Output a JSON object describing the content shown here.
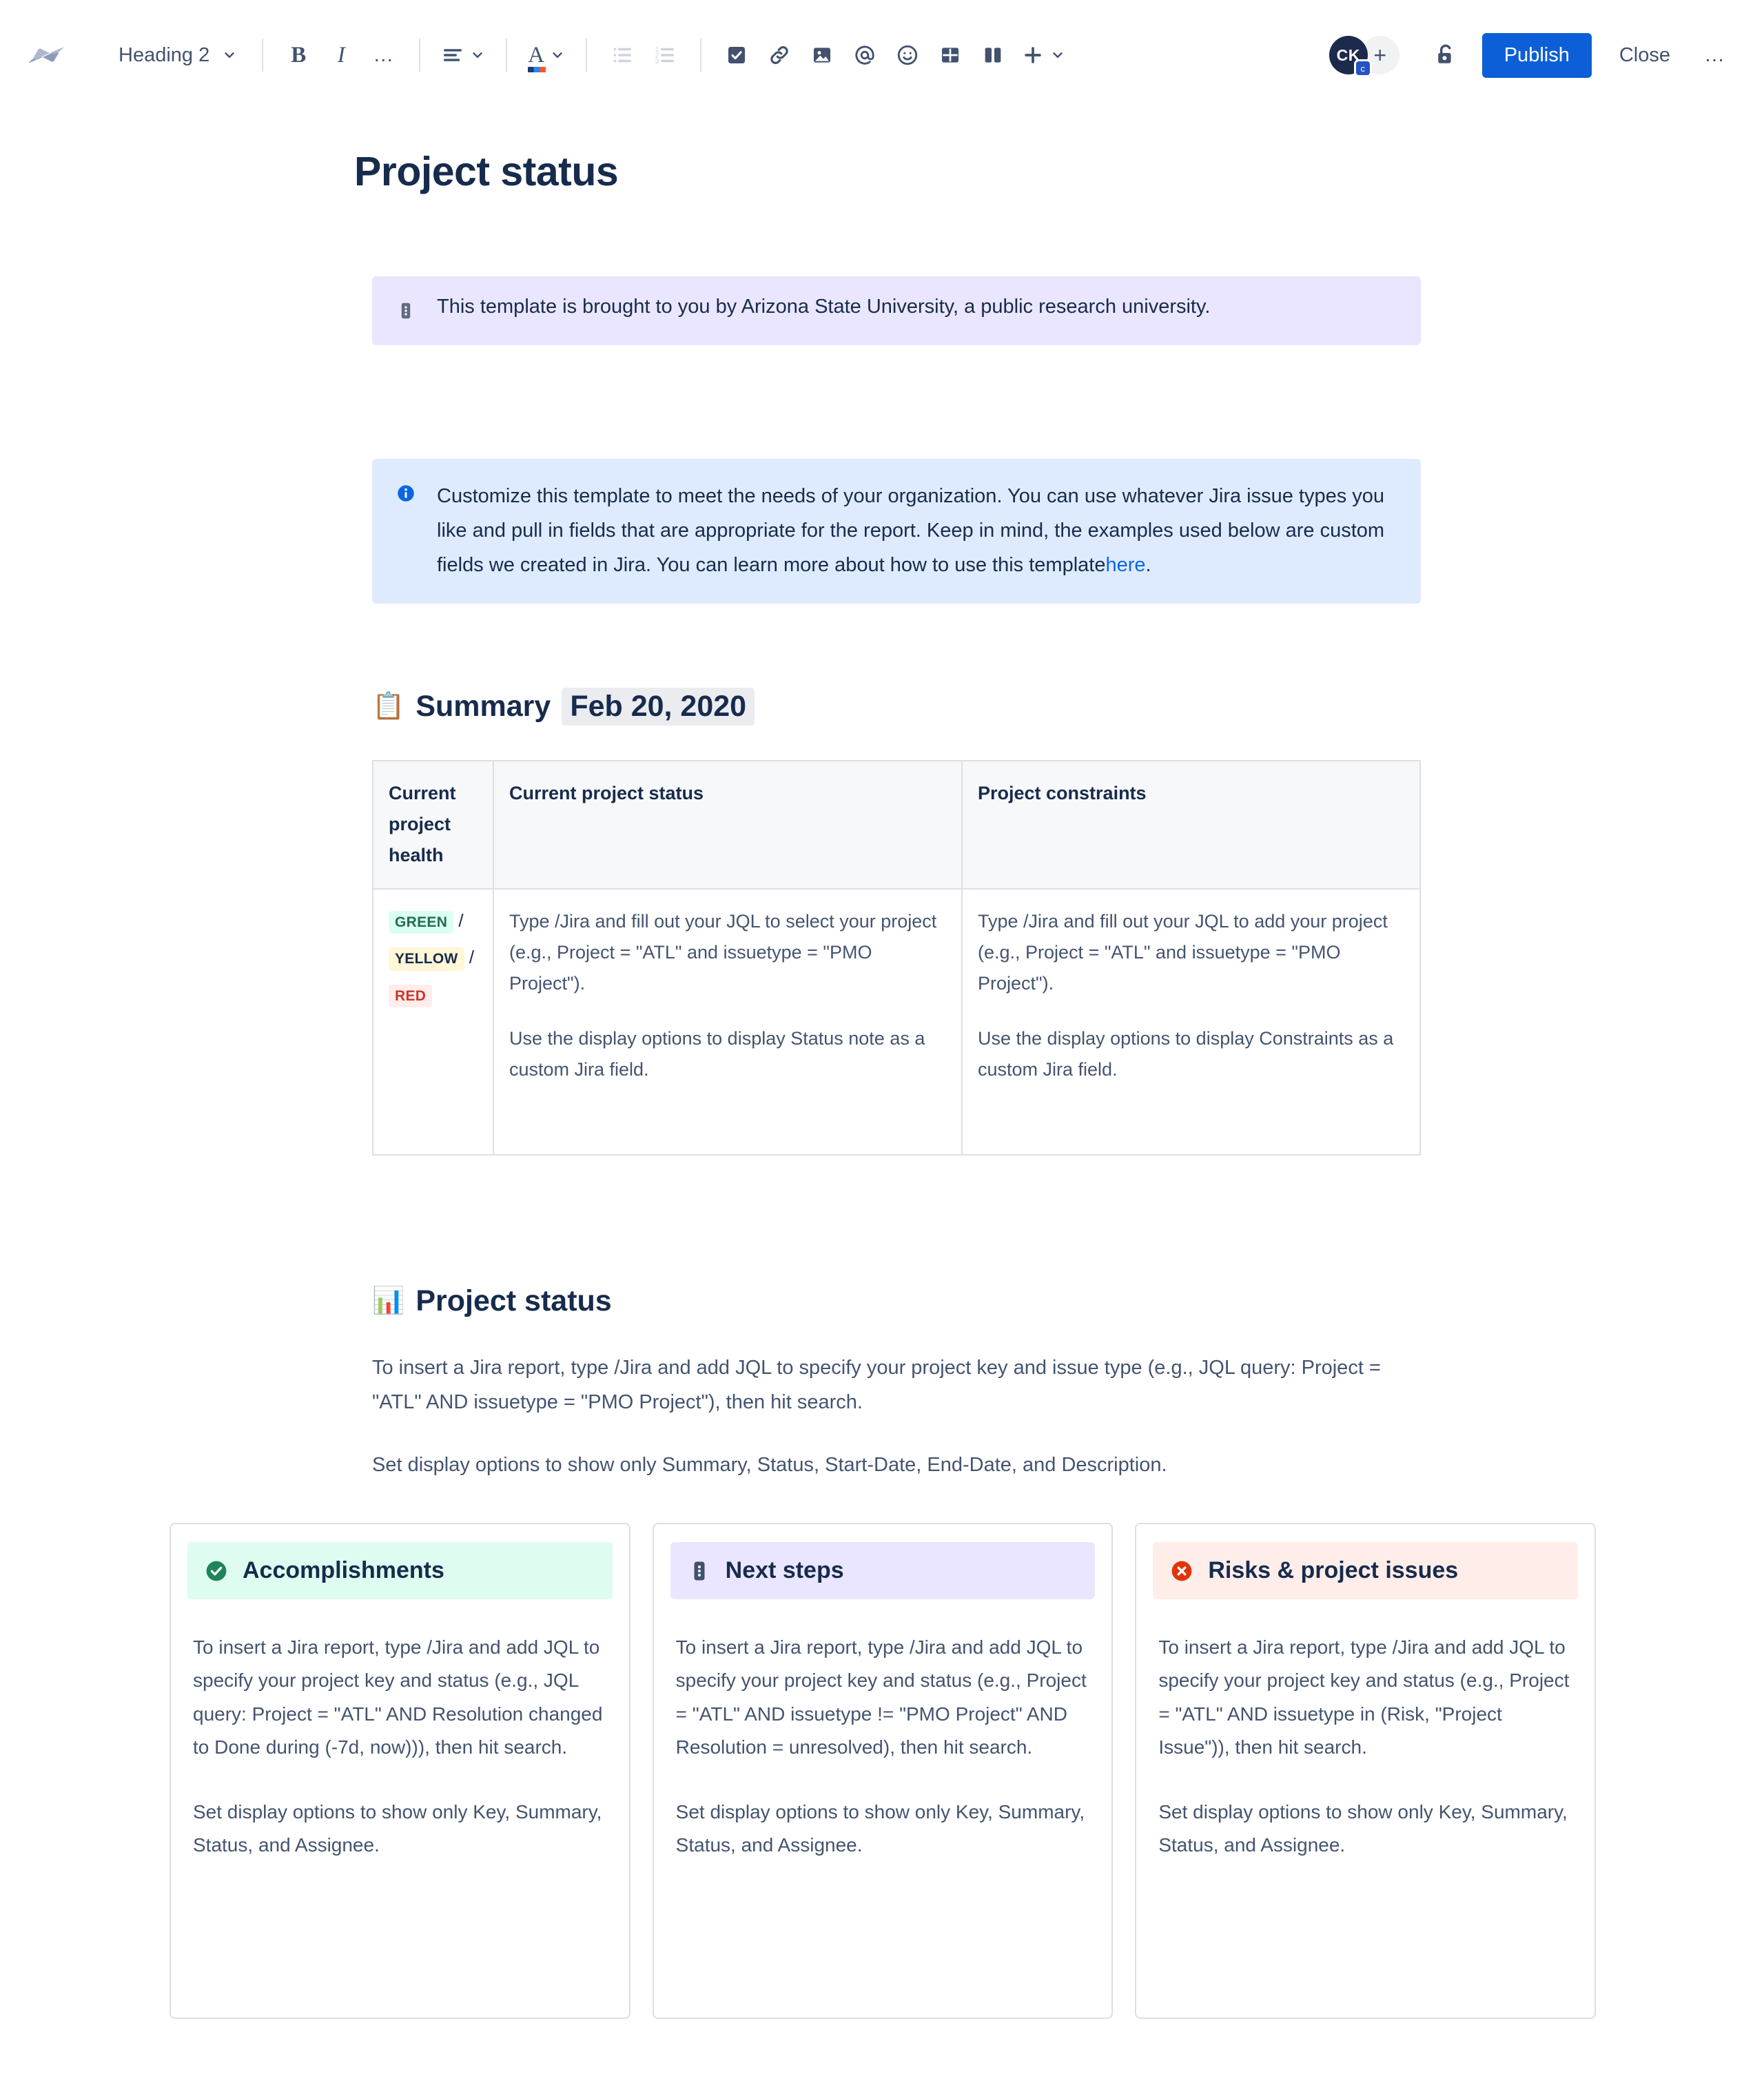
{
  "toolbar": {
    "logo_name": "confluence-logo",
    "heading_select": {
      "value": "Heading 2"
    },
    "buttons": {
      "bold": "B",
      "italic": "I",
      "more_formatting": "•••",
      "text_align": "align-left",
      "text_color": "A",
      "bullet_list": "bullet-list",
      "numbered_list": "numbered-list",
      "action_item": "task-checkbox",
      "link": "link",
      "image": "image",
      "mention": "@",
      "emoji": "emoji",
      "table": "table",
      "layouts": "layouts",
      "insert_more": "+"
    },
    "avatar": {
      "initials": "CK",
      "badge": "c"
    },
    "add_people": "+",
    "restrictions_icon": "unlock",
    "publish_label": "Publish",
    "close_label": "Close",
    "more_label": "•••",
    "accent_color": "#0C5FD6"
  },
  "document": {
    "title": "Project status",
    "note_panel": {
      "icon": "note-icon",
      "text": "This template is brought to you by Arizona State University, a public research university.",
      "bg": "#EAE6FF"
    },
    "info_panel": {
      "icon": "info-icon",
      "text_before_link": "Customize this template to meet the needs of your organization. You can use whatever Jira issue types you like and pull in fields that are appropriate for the report. Keep in mind, the examples used below are custom fields we created in Jira. You can learn more about how to use this template",
      "link_text": "here",
      "text_after_link": ".",
      "bg": "#DEEBFF"
    },
    "summary_section": {
      "emoji": "📋",
      "heading": "Summary",
      "date": "Feb 20, 2020"
    },
    "table": {
      "headers": [
        "Current project health",
        "Current project status",
        "Project constraints"
      ],
      "health_lozenges": [
        {
          "label": "GREEN",
          "color": "#216E4E",
          "bg": "#DCFFF1"
        },
        {
          "label": "YELLOW",
          "color": "#172B4D",
          "bg": "#FFF7D6"
        },
        {
          "label": "RED",
          "color": "#C9372C",
          "bg": "#FFEDEB"
        }
      ],
      "separator": "/",
      "status_cell": [
        "Type /Jira and fill out your JQL to select your project (e.g., Project = \"ATL\" and issuetype = \"PMO Project\").",
        "Use the display options to display Status note as a custom Jira field."
      ],
      "constraints_cell": [
        "Type /Jira and fill out your JQL to add your project (e.g., Project = \"ATL\" and issuetype = \"PMO Project\").",
        "Use the display options to display Constraints as a custom Jira field."
      ]
    },
    "status_section": {
      "emoji": "📊",
      "heading": "Project status",
      "paragraphs": [
        "To insert a Jira report, type /Jira and add JQL to specify your project key and issue type (e.g., JQL query: Project = \"ATL\" AND issuetype = \"PMO Project\"), then hit search.",
        "Set display options to show only Summary, Status, Start-Date, End-Date, and Description."
      ]
    },
    "cards": [
      {
        "icon": "check-circle-icon",
        "title": "Accomplishments",
        "header_bg": "#DFFCF0",
        "icon_color": "#1F845A",
        "paragraphs": [
          "To insert a Jira report, type /Jira and add JQL to specify your project key and status (e.g., JQL query: Project = \"ATL\" AND Resolution changed to Done during (-7d, now))), then hit search.",
          "Set display options to show only Key, Summary, Status, and Assignee."
        ]
      },
      {
        "icon": "note-icon",
        "title": "Next steps",
        "header_bg": "#EAE6FF",
        "icon_color": "#42526E",
        "paragraphs": [
          "To insert a Jira report, type /Jira and add JQL to specify your project key and status (e.g., Project = \"ATL\" AND issuetype != \"PMO Project\" AND Resolution = unresolved), then hit search.",
          "Set display options to show only Key, Summary, Status, and Assignee."
        ]
      },
      {
        "icon": "error-circle-icon",
        "title": "Risks & project issues",
        "header_bg": "#FFEDE9",
        "icon_color": "#DE350B",
        "paragraphs": [
          "To insert a Jira report, type /Jira and add JQL to specify your project key and status (e.g., Project = \"ATL\" AND issuetype in (Risk, \"Project Issue\")), then hit search.",
          "Set display options to show only Key, Summary, Status, and Assignee."
        ]
      }
    ]
  }
}
